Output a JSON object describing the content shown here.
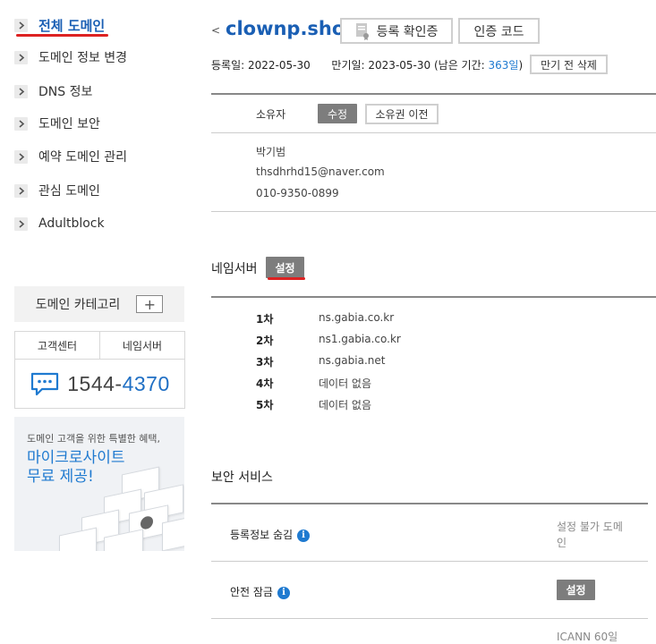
{
  "sidebar": {
    "items": [
      {
        "label": "전체 도메인"
      },
      {
        "label": "도메인 정보 변경"
      },
      {
        "label": "DNS 정보"
      },
      {
        "label": "도메인 보안"
      },
      {
        "label": "예약 도메인 관리"
      },
      {
        "label": "관심 도메인"
      },
      {
        "label": "Adultblock"
      }
    ],
    "category": {
      "label": "도메인 카테고리",
      "add": "+"
    },
    "support": {
      "tabs": [
        "고객센터",
        "네임서버"
      ],
      "phone_prefix": "1544-",
      "phone_suffix": "4370"
    },
    "banner": {
      "small": "도메인 고객을 위한 특별한 혜택,",
      "line1": "마이크로사이트",
      "line2": "무료 제공!"
    }
  },
  "header": {
    "back": "<",
    "domain": "clownp.shop",
    "reg_cert_button": "등록 확인증",
    "auth_code_button": "인증 코드",
    "registered_label": "등록일:",
    "registered_date": "2022-05-30",
    "expiry_label": "만기일:",
    "expiry_date": "2023-05-30",
    "remaining_prefix": "(남은 기간:",
    "remaining_days": "363일",
    "remaining_suffix": ")",
    "pre_expiry_delete_button": "만기 전 삭제"
  },
  "owner": {
    "label": "소유자",
    "edit_button": "수정",
    "transfer_button": "소유권 이전",
    "name": "박기범",
    "email": "thsdhrhd15@naver.com",
    "phone": "010-9350-0899"
  },
  "nameserver": {
    "title": "네임서버",
    "set_button": "설정",
    "rows": [
      {
        "label": "1차",
        "value": "ns.gabia.co.kr"
      },
      {
        "label": "2차",
        "value": "ns1.gabia.co.kr"
      },
      {
        "label": "3차",
        "value": "ns.gabia.net"
      },
      {
        "label": "4차",
        "value": "데이터 없음"
      },
      {
        "label": "5차",
        "value": "데이터 없음"
      }
    ]
  },
  "security": {
    "title": "보안 서비스",
    "rows": [
      {
        "label": "등록정보 숨김",
        "status_line1": "설정 불가 도메",
        "status_line2": "인"
      },
      {
        "label": "안전 잠금",
        "button": "설정"
      },
      {
        "partial": "ICANN 60일"
      }
    ]
  },
  "colors": {
    "accent": "#1f7ad0",
    "domain": "#1a5fb4",
    "underline": "#dd2222",
    "dark_button": "#7d7d7d"
  }
}
